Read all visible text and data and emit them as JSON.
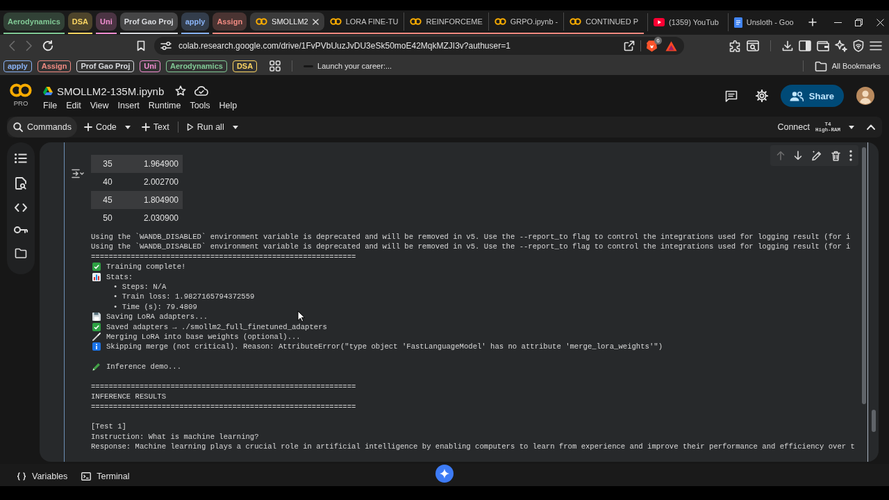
{
  "browser": {
    "tab_strip": [
      {
        "kind": "group",
        "label": "Aerodynamics",
        "color": "#81c995"
      },
      {
        "kind": "group",
        "label": "DSA",
        "color": "#fdd663"
      },
      {
        "kind": "group",
        "label": "Uni",
        "color": "#f48fd3"
      },
      {
        "kind": "group",
        "label": "Prof Gao Proj",
        "color": "#dadce0"
      },
      {
        "kind": "group",
        "label": "apply",
        "color": "#8ab4f8"
      },
      {
        "kind": "group",
        "label": "Assign",
        "color": "#f28b82",
        "tabs": [
          {
            "kind": "notebook_tab",
            "title": "SMOLLM2",
            "selected": true
          },
          {
            "kind": "notebook_tab",
            "title": "LORA FINE-TU",
            "selected": false
          },
          {
            "kind": "notebook_tab",
            "title": "REINFORCEME",
            "selected": false
          },
          {
            "kind": "notebook_tab",
            "title": "GRPO.ipynb -",
            "selected": false
          },
          {
            "kind": "notebook_tab",
            "title": "CONTINUED P",
            "selected": false
          }
        ]
      },
      {
        "kind": "video_tab",
        "title": "(1359) YouTub",
        "selected": false
      },
      {
        "kind": "document_tab",
        "title": "Unsloth - Goo",
        "selected": false
      }
    ],
    "nav": {
      "back_disabled": true,
      "forward_disabled": true
    },
    "url": "colab.research.google.com/drive/1FvPVbUuzJvDU3eSk50moE42MqkMZJI3v?authuser=1",
    "shields_count": "6",
    "bookmarks": [
      {
        "kind": "group",
        "label": "apply",
        "color": "#8ab4f8"
      },
      {
        "kind": "group",
        "label": "Assign",
        "color": "#f28b82"
      },
      {
        "kind": "group",
        "label": "Prof Gao Proj",
        "color": "#dadce0"
      },
      {
        "kind": "group",
        "label": "Uni",
        "color": "#f48fd3"
      },
      {
        "kind": "group",
        "label": "Aerodynamics",
        "color": "#81c995"
      },
      {
        "kind": "group",
        "label": "DSA",
        "color": "#fdd663"
      },
      {
        "kind": "link",
        "label": "Launch your career:..."
      }
    ],
    "all_bookmarks": "All Bookmarks"
  },
  "notebook": {
    "plan": "PRO",
    "title": "SMOLLM2-135M.ipynb",
    "menu": [
      "File",
      "Edit",
      "View",
      "Insert",
      "Runtime",
      "Tools",
      "Help"
    ],
    "share": "Share",
    "toolbar": {
      "commands": "Commands",
      "add_code": "Code",
      "add_text": "Text",
      "run_all": "Run all",
      "connect": "Connect",
      "gpu": "T4",
      "ram": "High-RAM"
    },
    "cell": {
      "move_up_disabled": true,
      "table_rows": [
        [
          "35",
          "1.964900"
        ],
        [
          "40",
          "2.002700"
        ],
        [
          "45",
          "1.804900"
        ],
        [
          "50",
          "2.030900"
        ]
      ],
      "output": [
        {
          "kind": "plain",
          "text": "Using the `WANDB_DISABLED` environment variable is deprecated and will be removed in v5. Use the --report_to flag to control the integrations used for logging result (for i"
        },
        {
          "kind": "plain",
          "text": "Using the `WANDB_DISABLED` environment variable is deprecated and will be removed in v5. Use the --report_to flag to control the integrations used for logging result (for i"
        },
        {
          "kind": "plain",
          "text": "============================================================"
        },
        {
          "kind": "done",
          "text": "Training complete!"
        },
        {
          "kind": "stats",
          "text": "Stats:"
        },
        {
          "kind": "sub",
          "text": "• Steps: N/A"
        },
        {
          "kind": "sub",
          "text": "• Train loss: 1.9827165794372559"
        },
        {
          "kind": "sub",
          "text": "• Time (s): 79.4809"
        },
        {
          "kind": "saving",
          "text": "Saving LoRA adapters..."
        },
        {
          "kind": "done",
          "text": "Saved adapters → ./smollm2_full_finetuned_adapters"
        },
        {
          "kind": "merging",
          "text": "Merging LoRA into base weights (optional)..."
        },
        {
          "kind": "info",
          "text": "Skipping merge (not critical). Reason: AttributeError(\"type object 'FastLanguageModel' has no attribute 'merge_lora_weights'\")"
        },
        {
          "kind": "gap"
        },
        {
          "kind": "demo",
          "text": "Inference demo..."
        },
        {
          "kind": "gap"
        },
        {
          "kind": "plain",
          "text": "============================================================"
        },
        {
          "kind": "plain",
          "text": "INFERENCE RESULTS"
        },
        {
          "kind": "plain",
          "text": "============================================================"
        },
        {
          "kind": "gap"
        },
        {
          "kind": "plain",
          "text": "[Test 1]"
        },
        {
          "kind": "plain",
          "text": "Instruction: What is machine learning?"
        },
        {
          "kind": "plain",
          "text": "Response: Machine learning plays a crucial role in artificial intelligence by enabling computers to learn from experience and improve their performance and efficiency over t"
        }
      ]
    }
  },
  "bottom_bar": {
    "variables": "Variables",
    "terminal": "Terminal"
  }
}
